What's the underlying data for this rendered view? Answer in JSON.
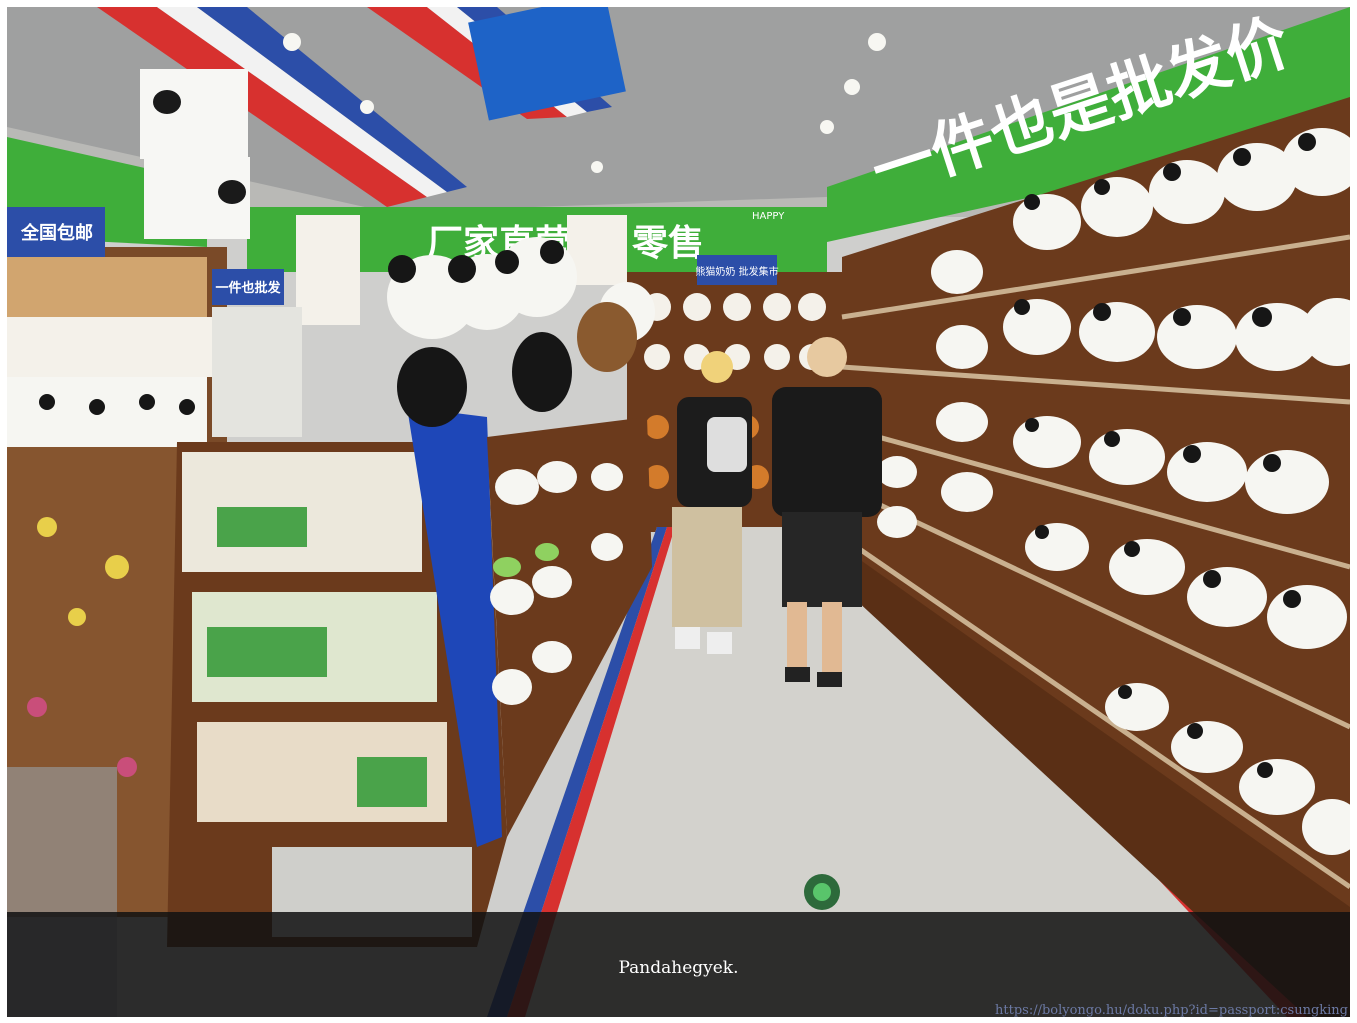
{
  "caption": "Pandahegyek.",
  "source_url": "https://bolyongo.hu/doku.php?id=passport:csungking",
  "colors": {
    "banner_green": "#3fae3a",
    "shelf_wood": "#6b3a1c",
    "floor": "#d3d2cd",
    "overlay": "#121212",
    "link": "#6c7aa5"
  },
  "scene": {
    "banner_right": "一件也是批发价",
    "banner_center_a": "厂家直营",
    "banner_center_b": "零售",
    "sign_left": "全国包邮",
    "sign_blue": "一件也批发",
    "sign_ceiling": "熊猫奶奶 批发集市",
    "sign_happy": "HAPPY"
  }
}
